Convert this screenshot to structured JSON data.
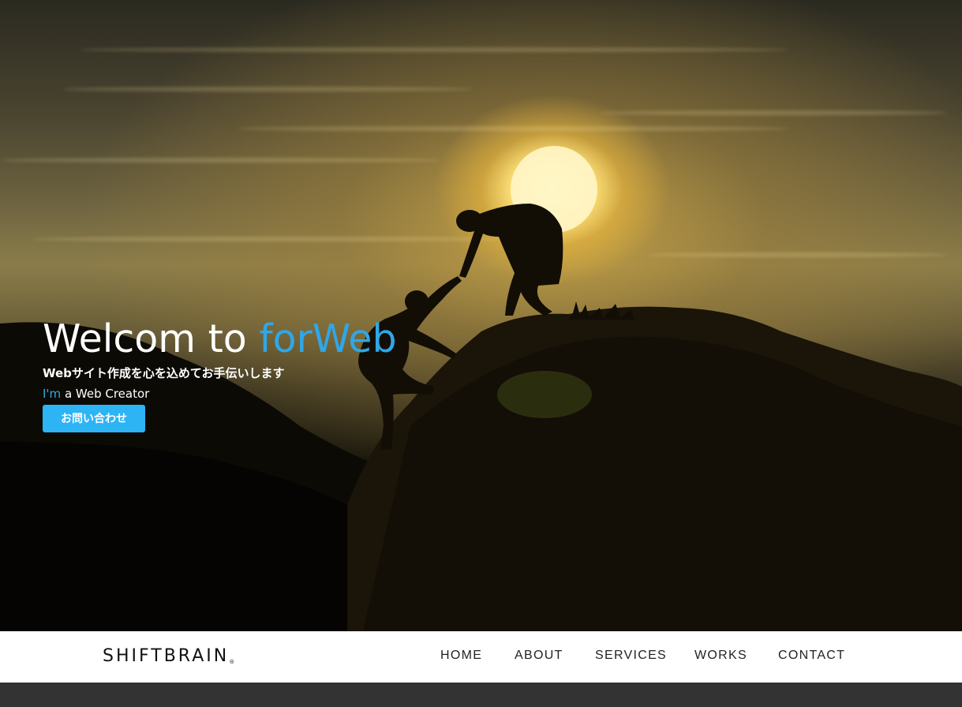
{
  "hero": {
    "title_main": "Welcom to ",
    "title_accent": "forWeb",
    "subtitle": "Webサイト作成を心を込めてお手伝いします",
    "role_accent": "I'm",
    "role_rest": " a Web Creator",
    "cta_label": "お問い合わせ"
  },
  "nav": {
    "logo": "SHIFTBRAIN",
    "logo_mark": "®",
    "items": [
      "HOME",
      "ABOUT",
      "SERVICES",
      "WORKS",
      "CONTACT"
    ]
  },
  "colors": {
    "accent": "#2fa7e8",
    "button": "#2cb4f5",
    "nav_bg": "#ffffff",
    "footer_bg": "#333333"
  }
}
